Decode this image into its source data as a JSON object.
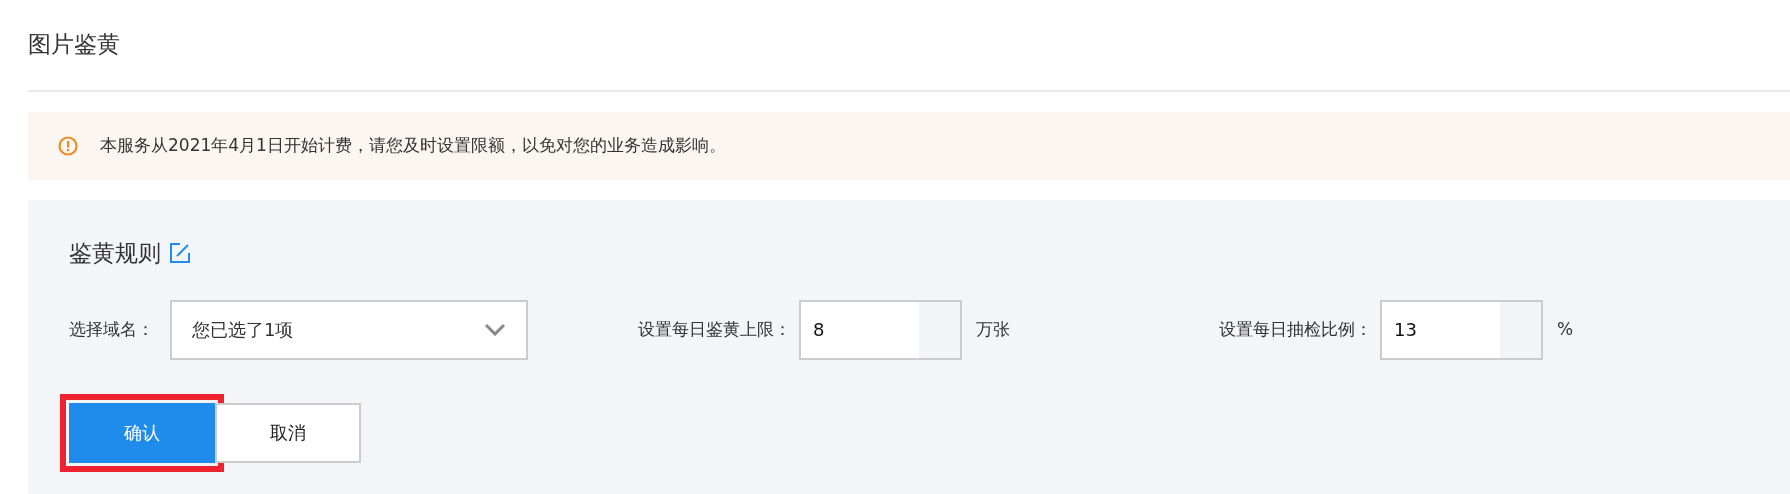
{
  "page_title": "图片鉴黄",
  "notice": {
    "text": "本服务从2021年4月1日开始计费，请您及时设置限额，以免对您的业务造成影响。"
  },
  "rules": {
    "title": "鉴黄规则",
    "fields": [
      {
        "kind": "select",
        "label": "选择域名：",
        "value": "您已选了1项"
      },
      {
        "kind": "number",
        "label": "设置每日鉴黄上限：",
        "value": "8",
        "unit": "万张"
      },
      {
        "kind": "number",
        "label": "设置每日抽检比例：",
        "value": "13",
        "unit": "%"
      }
    ],
    "buttons": [
      {
        "label": "确认",
        "kind": "primary",
        "highlighted": true
      },
      {
        "label": "取消",
        "kind": "secondary",
        "highlighted": false
      }
    ]
  }
}
